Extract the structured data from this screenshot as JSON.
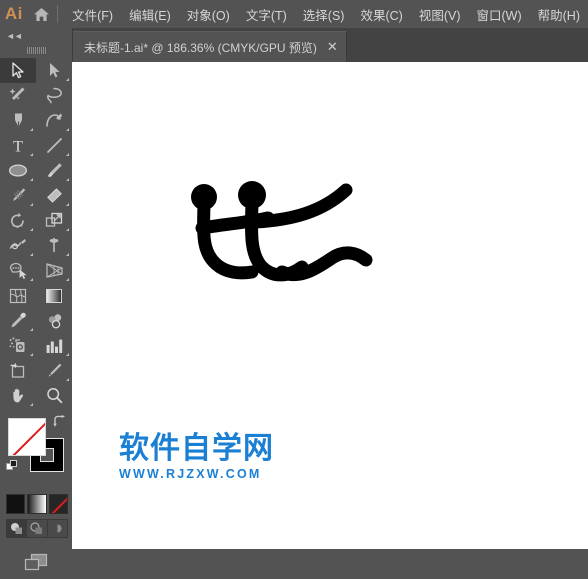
{
  "app": {
    "logo_text": "Ai",
    "home_icon": "home-icon",
    "background_color": "#535353",
    "canvas_color": "#ffffff",
    "accent_color": "#d08f55"
  },
  "menubar": {
    "items": [
      {
        "label": "文件(F)",
        "name": "menu-file"
      },
      {
        "label": "编辑(E)",
        "name": "menu-edit"
      },
      {
        "label": "对象(O)",
        "name": "menu-object"
      },
      {
        "label": "文字(T)",
        "name": "menu-type"
      },
      {
        "label": "选择(S)",
        "name": "menu-select"
      },
      {
        "label": "效果(C)",
        "name": "menu-effect"
      },
      {
        "label": "视图(V)",
        "name": "menu-view"
      },
      {
        "label": "窗口(W)",
        "name": "menu-window"
      },
      {
        "label": "帮助(H)",
        "name": "menu-help"
      }
    ]
  },
  "tabbar": {
    "tabs": [
      {
        "title": "未标题-1.ai* @ 186.36% (CMYK/GPU 预览)",
        "close_label": "✕",
        "active": true
      }
    ]
  },
  "toolpanel": {
    "collapse_label": "◄◄",
    "tools": [
      {
        "label": "选择工具",
        "name": "tool-selection",
        "active": true,
        "has_flyout": false
      },
      {
        "label": "直接选择工具",
        "name": "tool-direct-selection",
        "active": false,
        "has_flyout": true
      },
      {
        "label": "魔棒工具",
        "name": "tool-magic-wand",
        "active": false,
        "has_flyout": false
      },
      {
        "label": "套索工具",
        "name": "tool-lasso",
        "active": false,
        "has_flyout": false
      },
      {
        "label": "钢笔工具",
        "name": "tool-pen",
        "active": false,
        "has_flyout": true
      },
      {
        "label": "曲率工具",
        "name": "tool-curvature",
        "active": false,
        "has_flyout": true
      },
      {
        "label": "文字工具",
        "name": "tool-type",
        "active": false,
        "has_flyout": true
      },
      {
        "label": "直线段工具",
        "name": "tool-line-segment",
        "active": false,
        "has_flyout": true
      },
      {
        "label": "椭圆工具",
        "name": "tool-ellipse",
        "active": false,
        "has_flyout": true
      },
      {
        "label": "画笔工具",
        "name": "tool-paintbrush",
        "active": false,
        "has_flyout": true
      },
      {
        "label": "斑点画笔工具",
        "name": "tool-blob-brush",
        "active": false,
        "has_flyout": true
      },
      {
        "label": "橡皮擦工具",
        "name": "tool-eraser",
        "active": false,
        "has_flyout": true
      },
      {
        "label": "旋转工具",
        "name": "tool-rotate",
        "active": false,
        "has_flyout": true
      },
      {
        "label": "比例缩放工具",
        "name": "tool-scale",
        "active": false,
        "has_flyout": true
      },
      {
        "label": "宽度工具",
        "name": "tool-width",
        "active": false,
        "has_flyout": true
      },
      {
        "label": "自由变换工具",
        "name": "tool-free-transform",
        "active": false,
        "has_flyout": true
      },
      {
        "label": "形状生成器工具",
        "name": "tool-shape-builder",
        "active": false,
        "has_flyout": true
      },
      {
        "label": "透视网格工具",
        "name": "tool-perspective-grid",
        "active": false,
        "has_flyout": true
      },
      {
        "label": "网格工具",
        "name": "tool-mesh",
        "active": false,
        "has_flyout": false
      },
      {
        "label": "渐变工具",
        "name": "tool-gradient",
        "active": false,
        "has_flyout": false
      },
      {
        "label": "吸管工具",
        "name": "tool-eyedropper",
        "active": false,
        "has_flyout": true
      },
      {
        "label": "混合工具",
        "name": "tool-blend",
        "active": false,
        "has_flyout": false
      },
      {
        "label": "符号喷枪工具",
        "name": "tool-symbol-sprayer",
        "active": false,
        "has_flyout": true
      },
      {
        "label": "柱形图工具",
        "name": "tool-column-graph",
        "active": false,
        "has_flyout": true
      },
      {
        "label": "画板工具",
        "name": "tool-artboard",
        "active": false,
        "has_flyout": false
      },
      {
        "label": "切片工具",
        "name": "tool-slice",
        "active": false,
        "has_flyout": true
      },
      {
        "label": "抓手工具",
        "name": "tool-hand",
        "active": false,
        "has_flyout": true
      },
      {
        "label": "缩放工具",
        "name": "tool-zoom",
        "active": false,
        "has_flyout": false
      }
    ],
    "fill": {
      "label": "填色",
      "value": "无",
      "color": "#ffffff",
      "is_none": true
    },
    "stroke": {
      "label": "描边",
      "value": "黑色",
      "color": "#000000",
      "is_none": false
    },
    "swap_label": "互换填色和描边",
    "default_label": "默认填色和描边",
    "color_modes": [
      {
        "label": "颜色",
        "name": "mode-color",
        "active": false
      },
      {
        "label": "渐变",
        "name": "mode-gradient",
        "active": false
      },
      {
        "label": "无",
        "name": "mode-none",
        "active": true
      }
    ],
    "draw_modes": [
      {
        "label": "正常绘图",
        "name": "draw-mode-normal",
        "active": true
      },
      {
        "label": "背面绘图",
        "name": "draw-mode-behind",
        "active": false
      },
      {
        "label": "内部绘图",
        "name": "draw-mode-inside",
        "active": false
      }
    ],
    "screen_mode_label": "更改屏幕模式"
  },
  "canvas": {
    "artwork_label": "比 字形笔画图稿",
    "artwork_color": "#000000"
  },
  "watermark": {
    "title": "软件自学网",
    "url": "WWW.RJZXW.COM",
    "color": "#1b7fd4"
  }
}
